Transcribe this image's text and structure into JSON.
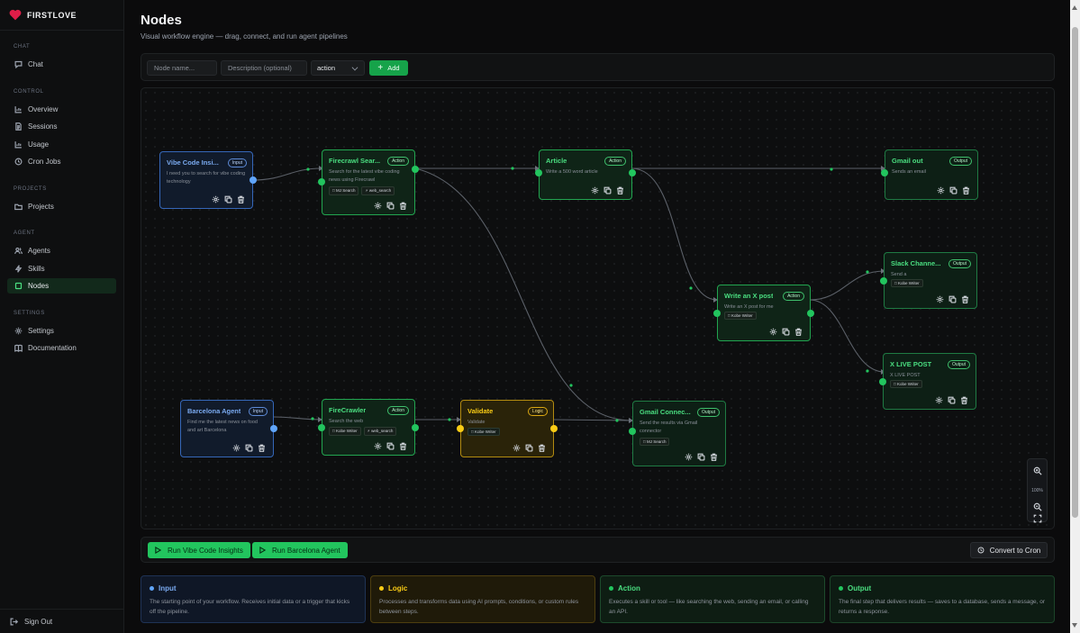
{
  "brand": {
    "name": "FIRSTLOVE"
  },
  "sidebar": {
    "sections": [
      {
        "label": "CHAT",
        "items": [
          {
            "label": "Chat",
            "icon": "chat-icon"
          }
        ]
      },
      {
        "label": "CONTROL",
        "items": [
          {
            "label": "Overview",
            "icon": "bar-chart-icon"
          },
          {
            "label": "Sessions",
            "icon": "document-icon"
          },
          {
            "label": "Usage",
            "icon": "bar-chart-icon"
          },
          {
            "label": "Cron Jobs",
            "icon": "clock-icon"
          }
        ]
      },
      {
        "label": "PROJECTS",
        "items": [
          {
            "label": "Projects",
            "icon": "folder-icon"
          }
        ]
      },
      {
        "label": "AGENT",
        "items": [
          {
            "label": "Agents",
            "icon": "users-icon"
          },
          {
            "label": "Skills",
            "icon": "bolt-icon"
          },
          {
            "label": "Nodes",
            "icon": "square-icon",
            "active": true
          }
        ]
      },
      {
        "label": "SETTINGS",
        "items": [
          {
            "label": "Settings",
            "icon": "gear-icon"
          },
          {
            "label": "Documentation",
            "icon": "book-icon"
          }
        ]
      }
    ],
    "signout": "Sign Out"
  },
  "page": {
    "title": "Nodes",
    "subtitle": "Visual workflow engine — drag, connect, and run agent pipelines"
  },
  "toolbar": {
    "name_placeholder": "Node name...",
    "desc_placeholder": "Description (optional)",
    "type_value": "action",
    "add_label": "Add"
  },
  "nodes": {
    "vibe": {
      "name": "Vibe Code Insi...",
      "badge": "Input",
      "desc": "I need you to search for vibe coding technology"
    },
    "firecrawl_search": {
      "name": "Firecrawl Sear...",
      "badge": "Action",
      "desc": "Search for the latest vibe coding news using Firecrawl",
      "chips": [
        "MJ Search",
        "web_search"
      ]
    },
    "article": {
      "name": "Article",
      "badge": "Action",
      "desc": "Write a 500 word article"
    },
    "gmail_out": {
      "name": "Gmail out",
      "badge": "Output",
      "desc": "Sends an email"
    },
    "slack": {
      "name": "Slack Channe...",
      "badge": "Output",
      "desc": "Send a",
      "chips": [
        "Kobe Writer"
      ]
    },
    "x_post": {
      "name": "Write an X post",
      "badge": "Action",
      "desc": "Write an X post for me",
      "chips": [
        "Kobe Writer"
      ]
    },
    "x_live": {
      "name": "X LIVE POST",
      "badge": "Output",
      "desc": "X LIVE POST",
      "chips": [
        "Kobe Writer"
      ]
    },
    "barcelona": {
      "name": "Barcelona Agent",
      "badge": "Input",
      "desc": "Find me the latest news on food and art Barcelona"
    },
    "firecrawler": {
      "name": "FireCrawler",
      "badge": "Action",
      "desc": "Search the web",
      "chips": [
        "Kobe Writer",
        "web_search"
      ]
    },
    "validate": {
      "name": "Validate",
      "badge": "Logic",
      "desc": "Validate",
      "chips": [
        "Kobe Writer"
      ]
    },
    "gmail_conn": {
      "name": "Gmail Connec...",
      "badge": "Output",
      "desc": "Send the results via Gmail connector",
      "chips": [
        "MJ Search"
      ]
    }
  },
  "zoom": {
    "level": "100%"
  },
  "runbar": {
    "run1": "Run Vibe Code Insights",
    "run2": "Run Barcelona Agent",
    "cron": "Convert to Cron"
  },
  "legend": {
    "input": {
      "title": "Input",
      "text": "The starting point of your workflow. Receives initial data or a trigger that kicks off the pipeline.",
      "color": "#60a5fa"
    },
    "logic": {
      "title": "Logic",
      "text": "Processes and transforms data using AI prompts, conditions, or custom rules between steps.",
      "color": "#facc15"
    },
    "action": {
      "title": "Action",
      "text": "Executes a skill or tool — like searching the web, sending an email, or calling an API.",
      "color": "#22c55e"
    },
    "output": {
      "title": "Output",
      "text": "The final step that delivers results — saves to a database, sends a message, or returns a response.",
      "color": "#22c55e"
    }
  }
}
